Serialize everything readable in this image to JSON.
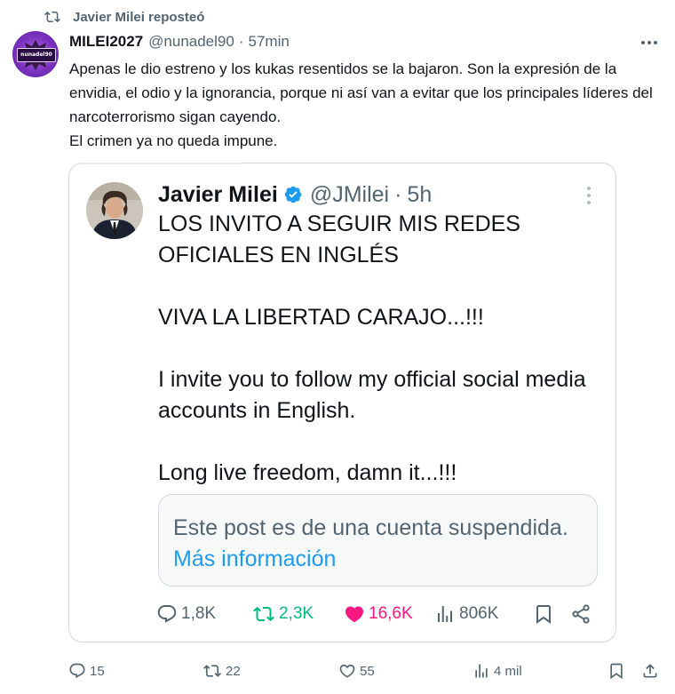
{
  "repost": {
    "label": "Javier Milei reposteó"
  },
  "tweet": {
    "display_name": "MILEI2027",
    "handle": "@nunadel90",
    "separator": "·",
    "time": "57min",
    "avatar_logo_text": "nunadel90",
    "text_lines": [
      "Apenas le dio estreno y los kukas resentidos se la bajaron. Son la expresión de la envidia, el odio y la ignorancia, porque ni así van a evitar que los principales líderes del narcoterrorismo sigan cayendo.",
      "El crimen ya no queda impune."
    ],
    "actions": {
      "replies": "15",
      "reposts": "22",
      "likes": "55",
      "views": "4 mil"
    }
  },
  "quote": {
    "display_name": "Javier Milei",
    "handle": "@JMilei",
    "separator": "·",
    "time": "5h",
    "paragraphs": [
      "LOS INVITO A SEGUIR MIS REDES OFICIALES EN INGLÉS",
      "VIVA LA LIBERTAD CARAJO...!!!",
      "I invite you to follow my official social media accounts in English.",
      "Long live freedom, damn it...!!!"
    ],
    "suspended_notice": {
      "text": "Este post es de una cuenta suspendida.",
      "link": "Más información"
    },
    "actions": {
      "replies": "1,8K",
      "reposts": "2,3K",
      "likes": "16,6K",
      "views": "806K"
    }
  },
  "colors": {
    "text_primary": "#0f1419",
    "text_secondary": "#536471",
    "link_blue": "#1d9bf0",
    "verified_blue": "#1d9bf0",
    "repost_green": "#00ba7c",
    "like_pink": "#f91880",
    "border": "#cfd9de",
    "avatar_purple": "#7a32c0"
  },
  "icons": {
    "repost_header": "repost-icon",
    "more": "more-dots-icon",
    "verified": "verified-badge-icon",
    "reply": "reply-icon",
    "repost": "repost-icon",
    "like": "heart-icon",
    "views": "views-chart-icon",
    "bookmark": "bookmark-icon",
    "share": "share-icon"
  }
}
